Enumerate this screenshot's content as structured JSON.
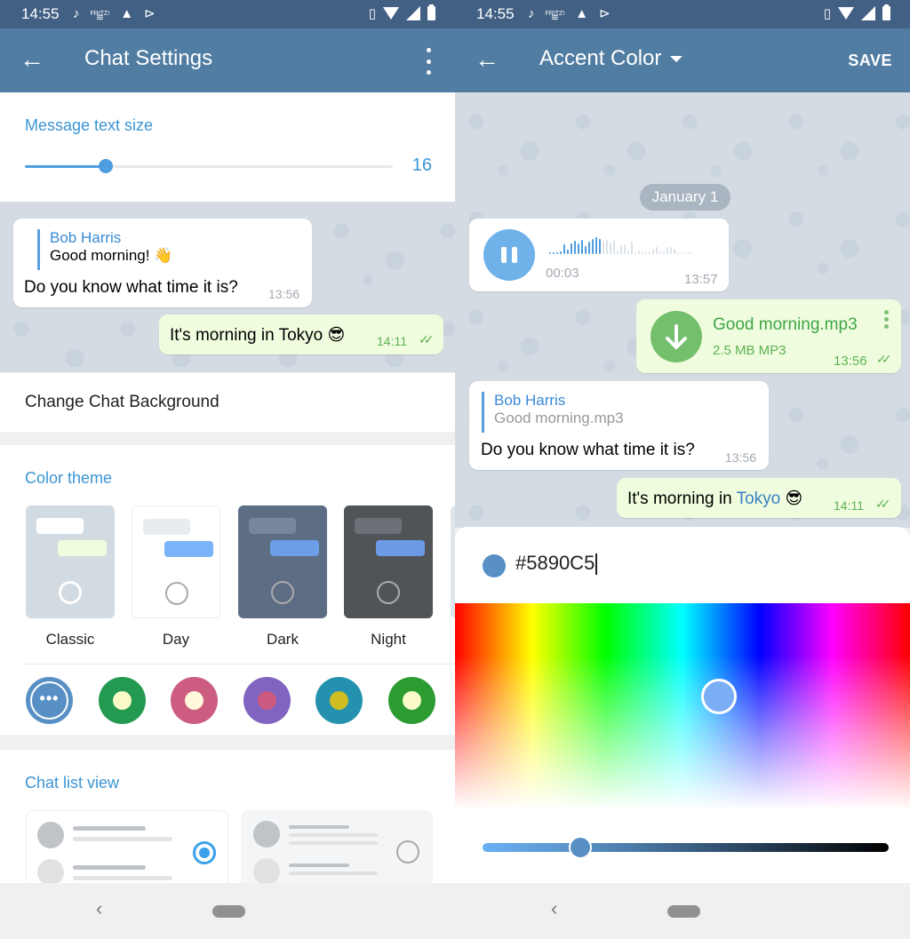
{
  "status_bar": {
    "time": "14:55",
    "notif_icons": [
      "music-icon",
      "fritz-wifi-icon",
      "warning-icon",
      "check-flag-icon"
    ],
    "system_icons": [
      "vibrate-icon",
      "wifi-icon",
      "signal-icon",
      "battery-icon"
    ],
    "fritz_label": "FRITZ!"
  },
  "left": {
    "appbar": {
      "title": "Chat Settings",
      "back_icon": "←",
      "more_icon": "more-vertical"
    },
    "text_size": {
      "title": "Message text size",
      "value": "16",
      "slider_fraction": 0.22
    },
    "preview": {
      "incoming": {
        "reply_name": "Bob Harris",
        "reply_text": "Good morning! 👋",
        "text": "Do you know what time it is?",
        "time": "13:56"
      },
      "outgoing": {
        "text": "It's morning in Tokyo 😎",
        "time": "14:11",
        "ticks": "✓✓"
      }
    },
    "change_background": "Change Chat Background",
    "color_theme": {
      "title": "Color theme",
      "themes": [
        {
          "label": "Classic",
          "bg": "#d2dbe2",
          "b1": "#ffffff",
          "b2": "#effdde",
          "selected": true
        },
        {
          "label": "Day",
          "bg": "#ffffff",
          "b1": "#e8ecf0",
          "b2": "#7ab3f8",
          "selected": false
        },
        {
          "label": "Dark",
          "bg": "#5d6d84",
          "b1": "#76869b",
          "b2": "#6d9ee8",
          "selected": false
        },
        {
          "label": "Night",
          "bg": "#515457",
          "b1": "#6c7078",
          "b2": "#6b9ae6",
          "selected": false
        }
      ],
      "accents": [
        {
          "name": "custom",
          "outer": "#5890c5",
          "inner": null,
          "glyph": "•••"
        },
        {
          "name": "green",
          "outer": "#239951",
          "inner": "#fafac8"
        },
        {
          "name": "pink",
          "outer": "#cc5c80",
          "inner": "#fff8dc"
        },
        {
          "name": "purple",
          "outer": "#8064c0",
          "inner": "#cc5a80"
        },
        {
          "name": "teal",
          "outer": "#2492ae",
          "inner": "#d0bd22"
        },
        {
          "name": "light-green",
          "outer": "#2c9c32",
          "inner": "#fafac8"
        }
      ]
    },
    "chat_list_view": {
      "title": "Chat list view",
      "options": [
        {
          "name": "two-line",
          "selected": true
        },
        {
          "name": "three-line",
          "selected": false
        }
      ]
    },
    "nav": {
      "back": "‹"
    }
  },
  "right": {
    "appbar": {
      "title": "Accent Color",
      "save": "SAVE"
    },
    "date": "January 1",
    "voice": {
      "duration": "00:03",
      "time": "13:57",
      "progress": 0.3
    },
    "file": {
      "name": "Good morning.mp3",
      "meta": "2.5 MB MP3",
      "time": "13:56",
      "ticks": "✓✓"
    },
    "reply_msg": {
      "reply_name": "Bob Harris",
      "reply_text": "Good morning.mp3",
      "text": "Do you know what time it is?",
      "time": "13:56"
    },
    "out_msg": {
      "text_before": "It's morning in ",
      "link": "Tokyo",
      "text_after": " 😎",
      "time": "14:11",
      "ticks": "✓✓"
    },
    "picker": {
      "hex": "#5890C5",
      "color": "#5890c5",
      "spectrum_pos": {
        "hue_fraction": 0.58,
        "sat_fraction": 0.45
      },
      "brightness_fraction": 0.24
    },
    "nav": {
      "back": "‹"
    }
  }
}
